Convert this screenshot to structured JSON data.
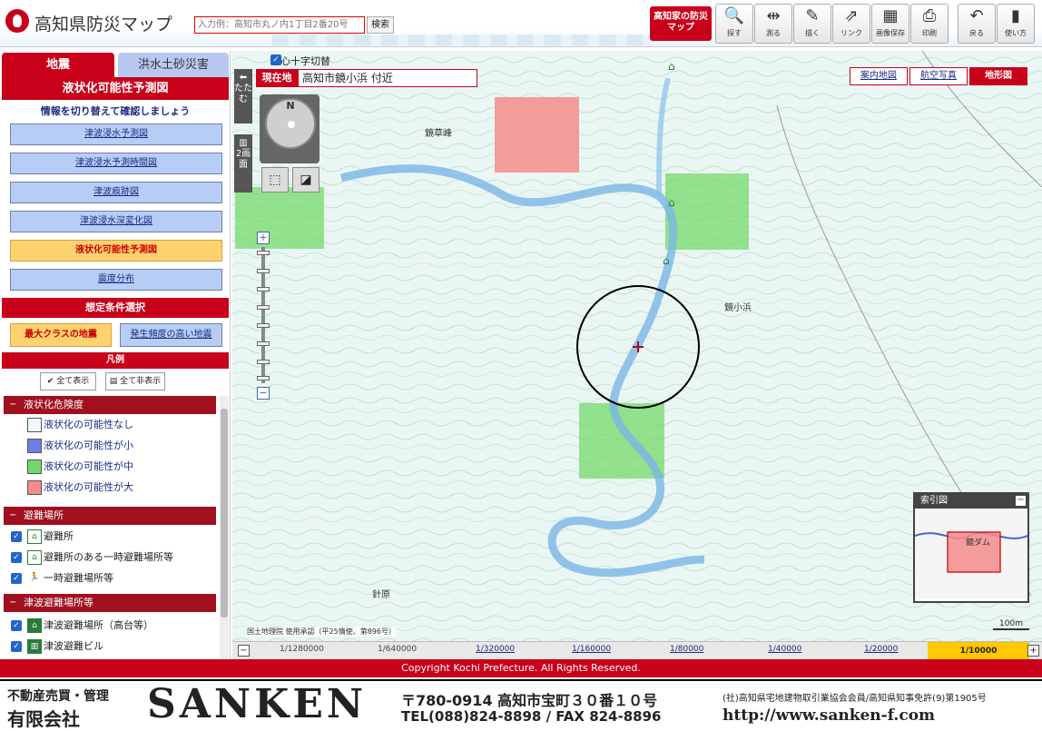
{
  "header": {
    "app_title": "高知県防災マップ",
    "search_placeholder": "入力例：高知市丸ノ内1丁目2番20号",
    "search_button": "検索",
    "mymap_button": "高知家の防災マップ",
    "tools": [
      {
        "label": "探す",
        "icon": "magnifier-icon",
        "glyph": "🔍"
      },
      {
        "label": "測る",
        "icon": "ruler-icon",
        "glyph": "⇹"
      },
      {
        "label": "描く",
        "icon": "draw-icon",
        "glyph": "✎"
      },
      {
        "label": "リンク",
        "icon": "link-icon",
        "glyph": "⇗"
      },
      {
        "label": "画像保存",
        "icon": "image-save-icon",
        "glyph": "▦"
      },
      {
        "label": "印刷",
        "icon": "printer-icon",
        "glyph": "⎙"
      },
      {
        "label": "戻る",
        "icon": "undo-icon",
        "glyph": "↶"
      },
      {
        "label": "使い方",
        "icon": "help-icon",
        "glyph": "▮"
      }
    ]
  },
  "sidebar": {
    "tabs": [
      "地震",
      "洪水土砂災害"
    ],
    "title": "液状化可能性予測図",
    "hint": "情報を切り替えて確認しましょう",
    "menu": [
      {
        "label": "津波浸水予測図",
        "active": false
      },
      {
        "label": "津波浸水予測時間図",
        "active": false
      },
      {
        "label": "津波痕跡図",
        "active": false
      },
      {
        "label": "津波浸水深変化図",
        "active": false
      },
      {
        "label": "液状化可能性予測図",
        "active": true
      },
      {
        "label": "震度分布",
        "active": false
      }
    ],
    "conditions_title": "想定条件選択",
    "conditions": [
      "最大クラスの地震",
      "発生頻度の高い地震"
    ],
    "legend_title": "凡例",
    "show_all": "全て表示",
    "hide_all": "全て非表示",
    "legend": {
      "liquefaction": {
        "title": "液状化危険度",
        "items": [
          {
            "label": "液状化の可能性なし",
            "color": "#eef8ff"
          },
          {
            "label": "液状化の可能性が小",
            "color": "#6f7ee6"
          },
          {
            "label": "液状化の可能性が中",
            "color": "#73d96b"
          },
          {
            "label": "液状化の可能性が大",
            "color": "#f48c8c"
          }
        ]
      },
      "shelters": {
        "title": "避難場所",
        "items": [
          "避難所",
          "避難所のある一時避難場所等",
          "一時避難場所等"
        ]
      },
      "tsunami": {
        "title": "津波避難場所等",
        "items": [
          "津波避難場所（高台等）",
          "津波避難ビル"
        ]
      }
    }
  },
  "map": {
    "crosshair_toggle": "中心十字切替",
    "current_location_label": "現在地",
    "current_location": "高知市鏡小浜 付近",
    "fold_tab": "たたむ",
    "split_tab": "2画面",
    "compass_north": "N",
    "map_types": [
      "案内地図",
      "航空写真",
      "地形図"
    ],
    "places": [
      "鏡草峰",
      "鏡小浜",
      "針原"
    ],
    "attribution": "国土地理院 使用承認（平25情使、第896号）",
    "scale_label": "100m",
    "index_map_title": "索引図",
    "index_map_label": "鏡ダム"
  },
  "scale_bar": {
    "items": [
      "1/1280000",
      "1/640000",
      "1/320000",
      "1/160000",
      "1/80000",
      "1/40000",
      "1/20000"
    ],
    "active": "1/10000"
  },
  "copyright": "Copyright Kochi Prefecture. All Rights Reserved.",
  "footer": {
    "tag1": "不動産売買・管理",
    "tag2": "有限会社",
    "logo": "SANKEN",
    "address": "〒780-0914 高知市宝町３０番１０号",
    "tel": "TEL(088)824-8898 / FAX 824-8896",
    "assoc": "(社)高知県宅地建物取引業協会会員/高知県知事免許(9)第1905号",
    "url": "http://www.sanken-f.com"
  }
}
